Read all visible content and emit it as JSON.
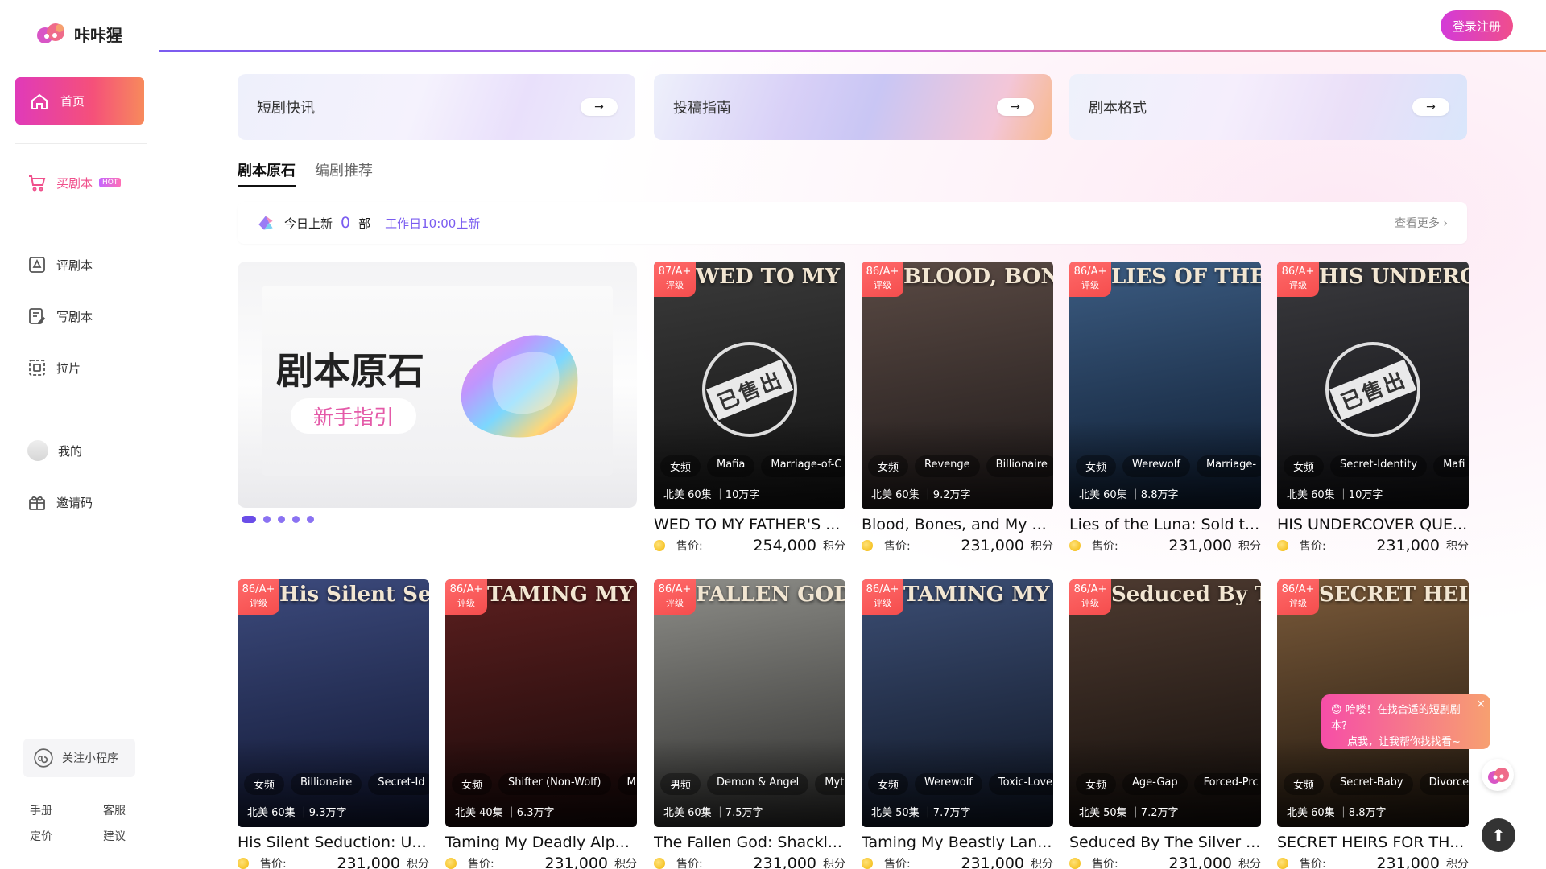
{
  "brand": {
    "name": "咔咔猩"
  },
  "header": {
    "login_label": "登录注册"
  },
  "sidebar": {
    "home": "首页",
    "buy": "买剧本",
    "hot_badge": "HOT",
    "review": "评剧本",
    "write": "写剧本",
    "breakdown": "拉片",
    "mine": "我的",
    "invite": "邀请码",
    "mini_program": "关注小程序",
    "manual": "手册",
    "service": "客服",
    "pricing": "定价",
    "suggest": "建议"
  },
  "quick_links": [
    "短剧快讯",
    "投稿指南",
    "剧本格式"
  ],
  "tabs": [
    "剧本原石",
    "编剧推荐"
  ],
  "today": {
    "label": "今日上新",
    "count": "0",
    "unit": "部",
    "schedule": "工作日10:00上新",
    "more": "查看更多"
  },
  "hero": {
    "title": "剧本原石",
    "button": "新手指引",
    "slides": 5,
    "active_slide": 1
  },
  "price_label": "售价:",
  "points_unit": "积分",
  "sold_label": "已售出",
  "books": [
    {
      "cover_title": "WED TO MY FATHER'S KILLER",
      "grade": "87/A+",
      "grade_sub": "评级",
      "tags": [
        "女频",
        "Mafia",
        "Marriage-of-C"
      ],
      "meta": "北美 60集 ｜10万字",
      "name": "WED TO MY FATHER'S ...",
      "price": "254,000",
      "sold": true,
      "colors": [
        "#3b3b3b",
        "#111"
      ]
    },
    {
      "cover_title": "BLOOD, BONES, AND BILLIONAIRE EX",
      "grade": "86/A+",
      "grade_sub": "评级",
      "tags": [
        "女频",
        "Revenge",
        "Billionaire"
      ],
      "meta": "北美 60集 ｜9.2万字",
      "name": "Blood, Bones, and My ...",
      "price": "231,000",
      "sold": false,
      "colors": [
        "#5a4a44",
        "#1d1818"
      ]
    },
    {
      "cover_title": "LIES OF THE LUNA: PACK ALPHA",
      "grade": "86/A+",
      "grade_sub": "评级",
      "tags": [
        "女频",
        "Werewolf",
        "Marriage-"
      ],
      "meta": "北美 60集 ｜8.8万字",
      "name": "Lies of the Luna: Sold t...",
      "price": "231,000",
      "sold": false,
      "colors": [
        "#3c5c82",
        "#0c1a2e"
      ]
    },
    {
      "cover_title": "HIS UNDERCOVER QUEEN",
      "grade": "86/A+",
      "grade_sub": "评级",
      "tags": [
        "女频",
        "Secret-Identity",
        "Mafi"
      ],
      "meta": "北美 60集 ｜10万字",
      "name": "HIS UNDERCOVER QUE...",
      "price": "231,000",
      "sold": true,
      "colors": [
        "#3a3a3e",
        "#0f0f12"
      ]
    },
    {
      "cover_title": "His Silent Seduction: Undercover Heiress",
      "grade": "86/A+",
      "grade_sub": "评级",
      "tags": [
        "女频",
        "Billionaire",
        "Secret-Id"
      ],
      "meta": "北美 60集 ｜9.3万字",
      "name": "His Silent Seduction: U...",
      "price": "231,000",
      "sold": false,
      "colors": [
        "#3c4a7c",
        "#0f1530"
      ]
    },
    {
      "cover_title": "TAMING MY DEADLY ALPHA LION",
      "grade": "86/A+",
      "grade_sub": "评级",
      "tags": [
        "女频",
        "Shifter (Non-Wolf)",
        "M"
      ],
      "meta": "北美 40集 ｜6.3万字",
      "name": "Taming My Deadly Alp...",
      "price": "231,000",
      "sold": false,
      "colors": [
        "#5c1f1f",
        "#150808"
      ]
    },
    {
      "cover_title": "FALLEN GOD",
      "grade": "86/A+",
      "grade_sub": "评级",
      "tags": [
        "男频",
        "Demon & Angel",
        "Myt"
      ],
      "meta": "北美 60集 ｜7.5万字",
      "name": "The Fallen God: Shackl...",
      "price": "231,000",
      "sold": false,
      "colors": [
        "#8d8d88",
        "#2b2b2a"
      ]
    },
    {
      "cover_title": "TAMING MY BEASTLY LANDLORD",
      "grade": "86/A+",
      "grade_sub": "评级",
      "tags": [
        "女频",
        "Werewolf",
        "Toxic-Love"
      ],
      "meta": "北美 50集 ｜7.7万字",
      "name": "Taming My Beastly Lan...",
      "price": "231,000",
      "sold": false,
      "colors": [
        "#3c4e74",
        "#0d1422"
      ]
    },
    {
      "cover_title": "Seduced By The Silver Fox: My Best Friend's Father",
      "grade": "86/A+",
      "grade_sub": "评级",
      "tags": [
        "女频",
        "Age-Gap",
        "Forced-Prc"
      ],
      "meta": "北美 50集 ｜7.2万字",
      "name": "Seduced By The Silver ...",
      "price": "231,000",
      "sold": false,
      "colors": [
        "#4d3a30",
        "#120d0a"
      ]
    },
    {
      "cover_title": "SECRET HEIRS OF THE BILLIONAIRE",
      "grade": "86/A+",
      "grade_sub": "评级",
      "tags": [
        "女频",
        "Secret-Baby",
        "Divorce"
      ],
      "meta": "北美 60集 ｜8.8万字",
      "name": "SECRET HEIRS FOR TH...",
      "price": "231,000",
      "sold": false,
      "colors": [
        "#7a5a3a",
        "#1c140c"
      ]
    }
  ],
  "assistant_tip": {
    "text_line1": "哈喽！在找合适的短剧剧本？",
    "text_line2": "点我，让我帮你找找看~",
    "close": "×"
  },
  "colors": {
    "accent": "#7a5cf0",
    "brand_pink": "#f0508c",
    "grade_red": "#f54d4d"
  }
}
